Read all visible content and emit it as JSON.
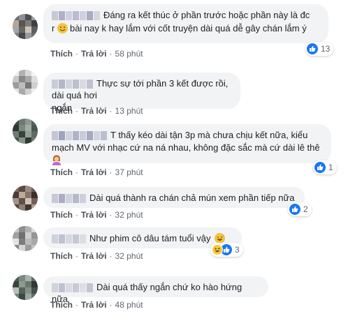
{
  "colors": {
    "bubble_bg": "#f2f3f5",
    "like_blue": "#1877f2",
    "action_text": "#4b4f56",
    "meta_text": "#606770"
  },
  "actions": {
    "like": "Thích",
    "reply": "Trả lời",
    "separator": "·"
  },
  "comments": [
    {
      "text_line1": "Đáng ra kết thúc ở phần trước hoặc phần này là đc",
      "text_prefix2": "r",
      "emoji2": "smile-emoji",
      "text_line2": "bài nay k hay lắm với cốt truyện dài quá dễ gây chán lắm ý",
      "time": "58 phút",
      "reaction_icon": "like-icon",
      "reaction_count": "13"
    },
    {
      "text_line1": "Thực sự tới phần 3 kết được rồi, dài quá hơi",
      "text_line2": "ngắn",
      "time": "13 phút"
    },
    {
      "text_line1": "T thấy kéo dài tận 3p mà chưa chịu kết nữa, kiểu",
      "text_line2": "mạch MV với nhạc cứ na ná nhau, không đặc sắc mà cứ dài lê thê",
      "emoji3": "woman-gesturing-emoji",
      "time": "37 phút",
      "reaction_icon": "like-icon",
      "reaction_count": "1"
    },
    {
      "text_line1": "Dài quá thành ra chán chả mún xem phần tiếp nữa",
      "time": "32 phút",
      "reaction_icon": "like-icon",
      "reaction_count": "2"
    },
    {
      "text_line1": "Như phim cô dâu tám tuổi vậy",
      "emoji_end": "grinning-sweat-emoji",
      "time": "32 phút",
      "reaction_icons": [
        "haha-icon",
        "like-icon"
      ],
      "reaction_count": "3"
    },
    {
      "text_line1": "Dài quá thấy ngắn chứ ko hào hứng nữa",
      "time": "48 phút"
    }
  ]
}
